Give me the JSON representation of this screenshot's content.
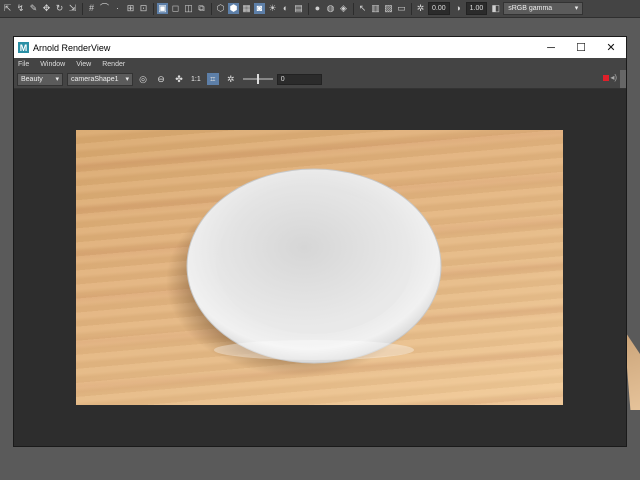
{
  "maya_toolbar": {
    "value_a": "0.00",
    "value_b": "1.00",
    "color_space": "sRGB gamma"
  },
  "render_view": {
    "title": "Arnold RenderView",
    "logo_letter": "M",
    "menus": [
      "File",
      "Window",
      "View",
      "Render"
    ],
    "aov": "Beauty",
    "camera": "cameraShape1",
    "zoom_ratio": "1:1",
    "exposure_value": "0"
  },
  "window_controls": {
    "minimize": "─",
    "maximize": "☐",
    "close": "✕"
  },
  "render_content": {
    "subject": "white plate on wooden table"
  },
  "colors": {
    "wood": "#e2b27c",
    "plate": "#ececec",
    "stop_button": "#e0202a",
    "selected_icon": "#5d7fa8"
  }
}
